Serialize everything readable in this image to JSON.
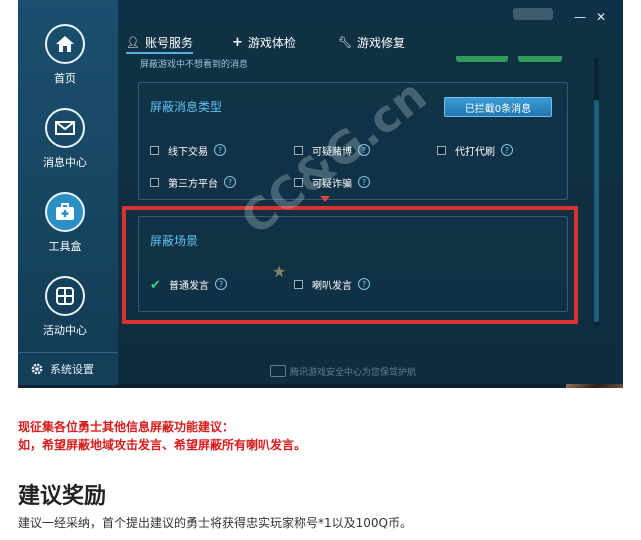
{
  "sidebar": {
    "items": [
      {
        "label": "首页",
        "icon": "home-icon"
      },
      {
        "label": "消息中心",
        "icon": "mail-icon"
      },
      {
        "label": "工具盒",
        "icon": "toolbox-icon"
      },
      {
        "label": "活动中心",
        "icon": "grid-icon"
      }
    ],
    "settings_label": "系统设置"
  },
  "tabs": [
    {
      "label": "账号服务",
      "icon": "user-icon"
    },
    {
      "label": "游戏体检",
      "icon": "plus-icon"
    },
    {
      "label": "游戏修复",
      "icon": "wrench-icon"
    }
  ],
  "window_controls": {
    "minimize": "—",
    "close": "✕"
  },
  "hint_text": "屏蔽游戏中不想看到的消息",
  "message_types": {
    "title": "屏蔽消息类型",
    "blocked_button": "已拦截0条消息",
    "options": [
      {
        "label": "线下交易",
        "checked": false
      },
      {
        "label": "可疑赌博",
        "checked": false
      },
      {
        "label": "代打代刷",
        "checked": false
      },
      {
        "label": "第三方平台",
        "checked": false
      },
      {
        "label": "可疑诈骗",
        "checked": false
      }
    ]
  },
  "scenes": {
    "title": "屏蔽场景",
    "options": [
      {
        "label": "普通发言",
        "checked": true
      },
      {
        "label": "喇叭发言",
        "checked": false
      }
    ]
  },
  "help_mark": "?",
  "footer_text": "腾讯游戏安全中心为您保驾护航",
  "watermark": "CC&G.cn",
  "article": {
    "red_lines": [
      "现征集各位勇士其他信息屏蔽功能建议：",
      "如，希望屏蔽地域攻击发言、希望屏蔽所有喇叭发言。"
    ],
    "heading": "建议奖励",
    "body": "建议一经采纳，首个提出建议的勇士将获得忠实玩家称号*1以及100Q币。"
  },
  "colors": {
    "accent": "#5fc2f2",
    "highlight_border": "#d6342f",
    "check": "#3fd17a",
    "red_text": "#d81e1e"
  }
}
